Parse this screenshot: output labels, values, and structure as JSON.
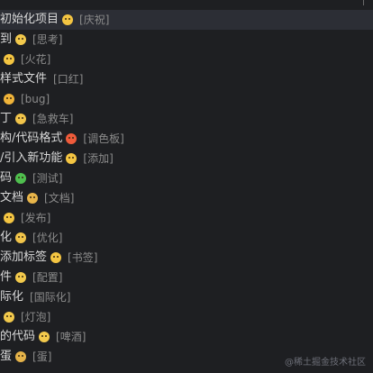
{
  "items": [
    {
      "label": "初始化项目",
      "hint": "[庆祝]",
      "emoji_color": "#f4c542",
      "emoji_name": "party-face-icon",
      "selected": true
    },
    {
      "label": "到",
      "hint": "[思考]",
      "emoji_color": "#f2c94c",
      "emoji_name": "thinking-face-icon"
    },
    {
      "label": "",
      "hint": "[火花]",
      "emoji_color": "#f4c542",
      "emoji_name": "sparkle-face-icon"
    },
    {
      "label": "样式文件",
      "hint": "[口红]",
      "emoji_color": "#e0a43a",
      "emoji_name": "lipstick-face-icon"
    },
    {
      "label": "",
      "hint": "[bug]",
      "emoji_color": "#f0b43a",
      "emoji_name": "bug-face-icon"
    },
    {
      "label": "丁",
      "hint": "[急救车]",
      "emoji_color": "#f1c44a",
      "emoji_name": "ambulance-face-icon"
    },
    {
      "label": "构/代码格式",
      "hint": "[调色板]",
      "emoji_color": "#ef5b3b",
      "emoji_name": "star-eyes-face-icon"
    },
    {
      "label": "/引入新功能",
      "hint": "[添加]",
      "emoji_color": "#f4c542",
      "emoji_name": "yum-face-icon"
    },
    {
      "label": "码",
      "hint": "[测试]",
      "emoji_color": "#4fbf4f",
      "emoji_name": "green-face-icon"
    },
    {
      "label": "文档",
      "hint": "[文档]",
      "emoji_color": "#e8b54a",
      "emoji_name": "nerd-face-icon"
    },
    {
      "label": "",
      "hint": "[发布]",
      "emoji_color": "#f4c542",
      "emoji_name": "grin-face-icon"
    },
    {
      "label": "化",
      "hint": "[优化]",
      "emoji_color": "#f1c44a",
      "emoji_name": "wink-tongue-face-icon"
    },
    {
      "label": "添加标签",
      "hint": "[书签]",
      "emoji_color": "#f4c542",
      "emoji_name": "happy-face-icon"
    },
    {
      "label": "件",
      "hint": "[配置]",
      "emoji_color": "#f2c94c",
      "emoji_name": "rolling-eyes-face-icon"
    },
    {
      "label": "际化",
      "hint": "[国际化]",
      "emoji_color": "",
      "emoji_name": ""
    },
    {
      "label": "",
      "hint": "[灯泡]",
      "emoji_color": "#f2c94c",
      "emoji_name": "neutral-face-icon"
    },
    {
      "label": "的代码",
      "hint": "[啤酒]",
      "emoji_color": "#f2c94c",
      "emoji_name": "smirk-face-icon"
    },
    {
      "label": "蛋",
      "hint": "[蛋]",
      "emoji_color": "#e5b34a",
      "emoji_name": "glasses-face-icon"
    }
  ],
  "watermark": "@稀土掘金技术社区"
}
